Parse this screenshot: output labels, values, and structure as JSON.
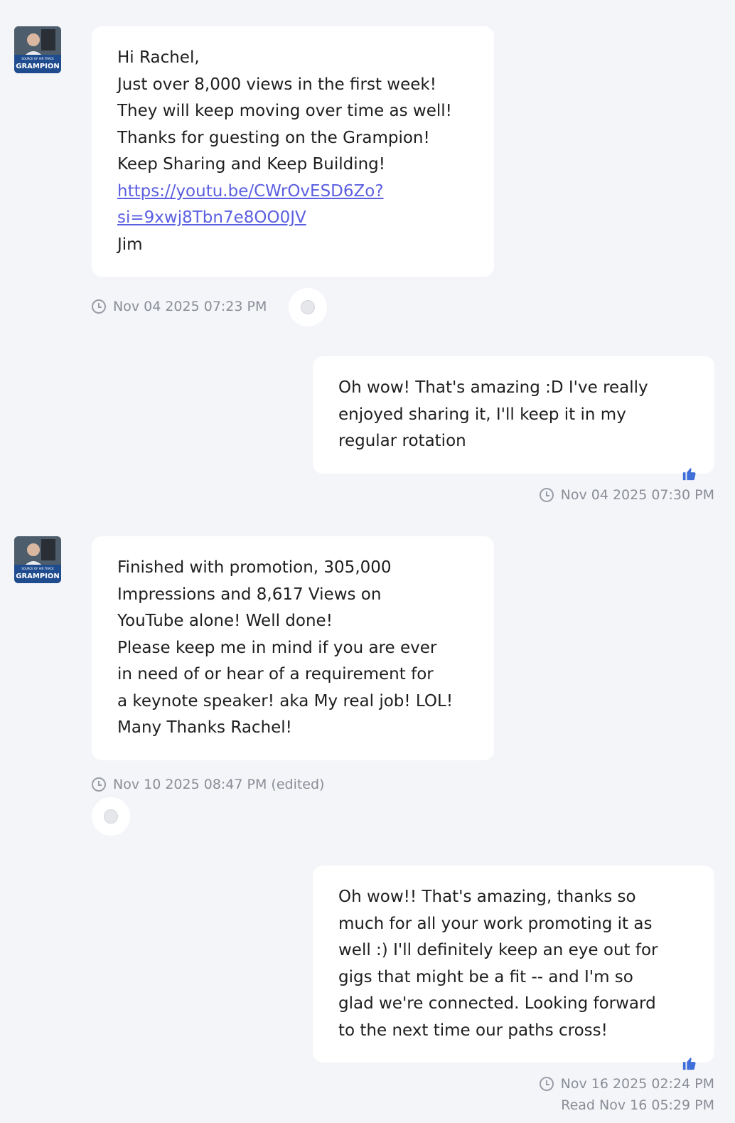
{
  "messages": [
    {
      "lines": [
        "Hi Rachel,",
        "Just over 8,000 views in the first week!",
        "They will keep moving over time as well!",
        "Thanks for guesting on the Grampion!",
        "Keep Sharing and Keep Building!"
      ],
      "link_lines": [
        "https://youtu.be/CWrOvESD6Zo?",
        "si=9xwj8Tbn7e8OO0JV"
      ],
      "signature": "Jim",
      "timestamp": "Nov 04 2025 07:23 PM"
    },
    {
      "lines": [
        "Oh wow! That's amazing :D I've really",
        "enjoyed sharing it, I'll keep it in my",
        "regular rotation"
      ],
      "timestamp": "Nov 04 2025 07:30 PM"
    },
    {
      "lines": [
        "Finished with promotion, 305,000",
        "Impressions and 8,617 Views on",
        "YouTube alone! Well done!",
        "Please keep me in mind if you are ever",
        "in need of or hear of a requirement for",
        "a keynote speaker! aka My real job! LOL!",
        "Many Thanks Rachel!"
      ],
      "timestamp": "Nov 10 2025 08:47 PM (edited)"
    },
    {
      "lines": [
        "Oh wow!! That's amazing, thanks so",
        "much for all your work promoting it as",
        "well :) I'll definitely keep an eye out for",
        "gigs that might be a fit -- and I'm so",
        "glad we're connected. Looking forward",
        "to the next time our paths cross!"
      ],
      "timestamp": "Nov 16 2025 02:24 PM",
      "read_receipt": "Read Nov 16 05:29 PM"
    }
  ],
  "avatar": {
    "brand_text": "GRAMPION",
    "tagline_text": "SOURCE OF AIR TRACK"
  },
  "colors": {
    "background": "#f4f5f9",
    "bubble": "#ffffff",
    "link": "#5b5fe0",
    "meta_text": "#8a8d96",
    "thumb": "#3f6fd8"
  },
  "icons": {
    "timestamp": "clock-icon",
    "reaction": "smiley-icon",
    "liked": "thumbs-up-icon"
  }
}
